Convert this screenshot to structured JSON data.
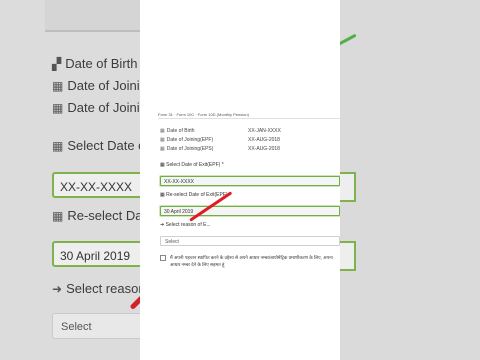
{
  "background": {
    "rows": [
      {
        "icon": "birthday-cake-icon",
        "label": "Date of Birth"
      },
      {
        "icon": "calendar-icon",
        "label": "Date of Joining("
      },
      {
        "icon": "calendar-icon",
        "label": "Date of Joining"
      }
    ],
    "select_doe_label": "Select Date of E",
    "doe_value": "XX-XX-XXXX",
    "reselect_label": "Re-select Date o",
    "reselect_value": "30 April 2019",
    "reason_label": "Select reason o",
    "select_value": "Select"
  },
  "form": {
    "crumbs": "Form 31 · Form 10C · Form 10D (Monthly Pension)",
    "rows": [
      {
        "icon": "calendar-icon",
        "label": "Date of Birth",
        "value": "XX-JAN-XXXX"
      },
      {
        "icon": "calendar-icon",
        "label": "Date of Joining(EPF)",
        "value": "XX-AUG-2018"
      },
      {
        "icon": "calendar-icon",
        "label": "Date of Joining(EPS)",
        "value": "XX-AUG-2018"
      }
    ],
    "doe_label": "Select Date of Exit(EPF) *",
    "doe_value": "XX-XX-XXXX",
    "reselect_label": "Re-select Date of Exit(EPF) *",
    "reselect_value": "30 April 2019",
    "reason_label": "Select reason of E...",
    "reason_value": "Select",
    "declaration": "मैं अपनी पहचान स्थापित करने के उद्देश्य से अपने आधार नम्बर/बायोमेट्रिक प्रमाणीकरण के लिए, अपना आधार नम्बर देने के लिए सहमत हूं"
  },
  "colors": {
    "valid_border": "#6fae45",
    "annotation": "#e01b24"
  }
}
